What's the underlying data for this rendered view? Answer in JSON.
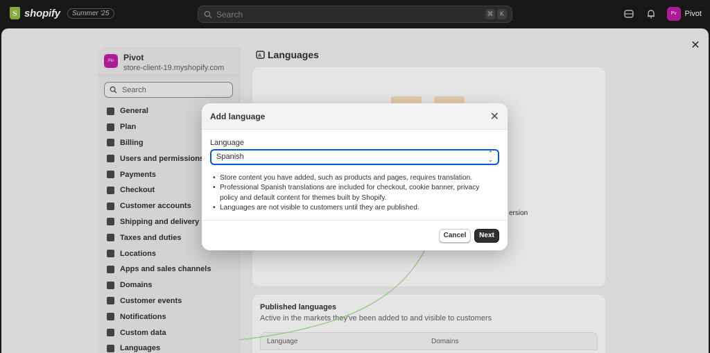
{
  "topbar": {
    "brand": "shopify",
    "edition": "Summer '25",
    "search_placeholder": "Search",
    "kbd1": "⌘",
    "kbd2": "K",
    "user_initials": "Pv",
    "user_name": "Pivot"
  },
  "sidebar": {
    "store_initials": "Piv",
    "store_name": "Pivot",
    "store_domain": "store-client-19.myshopify.com",
    "search_placeholder": "Search",
    "items": [
      {
        "label": "General",
        "icon": "store-icon"
      },
      {
        "label": "Plan",
        "icon": "chart-icon"
      },
      {
        "label": "Billing",
        "icon": "receipt-icon"
      },
      {
        "label": "Users and permissions",
        "icon": "users-icon"
      },
      {
        "label": "Payments",
        "icon": "payments-icon"
      },
      {
        "label": "Checkout",
        "icon": "cart-icon"
      },
      {
        "label": "Customer accounts",
        "icon": "person-icon"
      },
      {
        "label": "Shipping and delivery",
        "icon": "truck-icon"
      },
      {
        "label": "Taxes and duties",
        "icon": "tax-icon"
      },
      {
        "label": "Locations",
        "icon": "pin-icon"
      },
      {
        "label": "Apps and sales channels",
        "icon": "apps-icon"
      },
      {
        "label": "Domains",
        "icon": "globe-icon"
      },
      {
        "label": "Customer events",
        "icon": "cursor-icon"
      },
      {
        "label": "Notifications",
        "icon": "bell-icon"
      },
      {
        "label": "Custom data",
        "icon": "data-icon"
      },
      {
        "label": "Languages",
        "icon": "language-icon"
      }
    ]
  },
  "main": {
    "title": "Languages",
    "card_text": "ersion",
    "published": {
      "title": "Published languages",
      "subtitle": "Active in the markets they've been added to and visible to customers",
      "col_language": "Language",
      "col_domains": "Domains"
    }
  },
  "dialog": {
    "title": "Add language",
    "field_label": "Language",
    "selected": "Spanish",
    "bullets": [
      "Store content you have added, such as products and pages, requires translation.",
      "Professional Spanish translations are included for checkout, cookie banner, privacy policy and default content for themes built by Shopify.",
      "Languages are not visible to customers until they are published."
    ],
    "cancel_label": "Cancel",
    "next_label": "Next"
  },
  "colors": {
    "accent": "#005bd3",
    "avatar": "#c11ea5",
    "brand_green": "#95bf47"
  }
}
